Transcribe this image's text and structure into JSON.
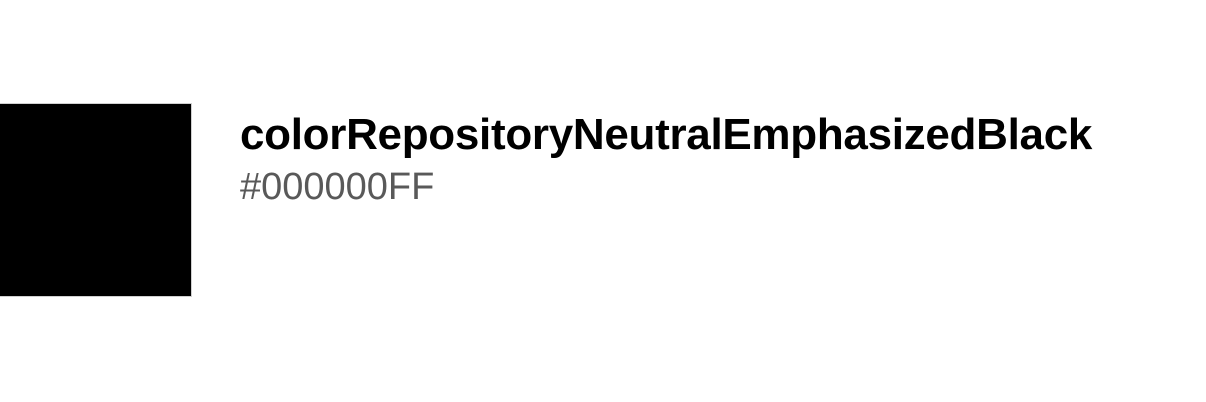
{
  "swatch": {
    "name": "colorRepositoryNeutralEmphasizedBlack",
    "value": "#000000FF",
    "color": "#000000",
    "border_color": "#d0d0d0"
  },
  "colors": {
    "name_text": "#000000",
    "value_text": "#595959",
    "background": "#ffffff"
  }
}
